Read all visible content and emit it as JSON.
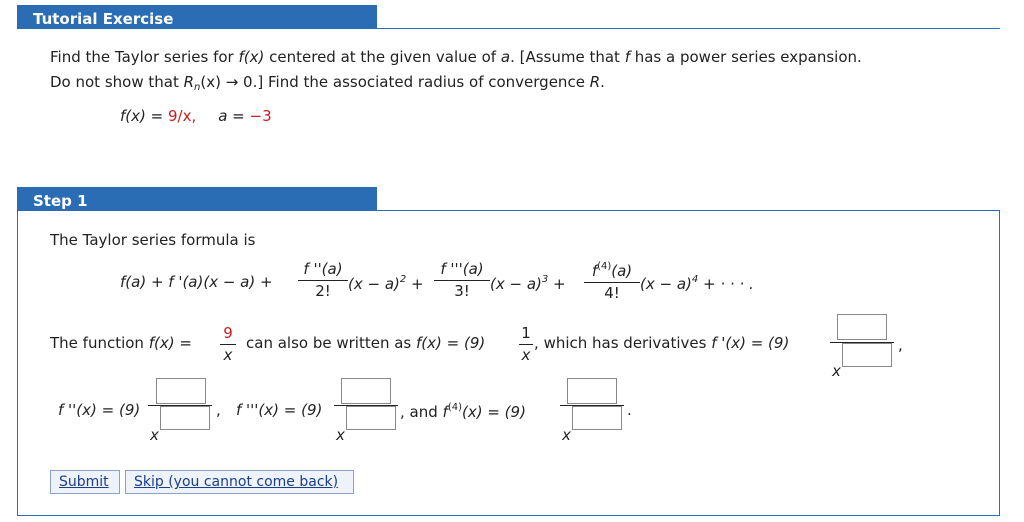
{
  "tutorial": {
    "header": "Tutorial Exercise",
    "line1_a": "Find the Taylor series for ",
    "line1_fx": "f(x)",
    "line1_b": " centered at the given value of ",
    "line1_a_var": "a",
    "line1_c": ". [Assume that ",
    "line1_f": "f",
    "line1_d": " has a power series expansion.",
    "line2_a": "Do not show that ",
    "line2_rn": "R",
    "line2_n": "n",
    "line2_b": "(x) → 0.] Find the associated radius of convergence ",
    "line2_R": "R",
    "line2_c": ".",
    "given_f": "f(x) = ",
    "given_fval": "9/x,",
    "given_a": "a = ",
    "given_aval": "−3"
  },
  "step1": {
    "header": "Step 1",
    "intro": "The Taylor series formula is",
    "formula": {
      "t0": "f(a) + f '(a)(x − a) + ",
      "n2": "f ''(a)",
      "d2": "2!",
      "t2": "(x − a)",
      "p2": "2",
      "plus": " + ",
      "n3": "f '''(a)",
      "d3": "3!",
      "t3": "(x − a)",
      "p3": "3",
      "n4a": "f",
      "n4p": "(4)",
      "n4b": "(a)",
      "d4": "4!",
      "t4": "(x − a)",
      "p4": "4",
      "tail": " + · · · ."
    },
    "func_intro": "The function ",
    "fx_eq": "f(x) = ",
    "num9": "9",
    "den_x": "x",
    "also": "can also be written as ",
    "fx_eq2": "f(x) = (9)",
    "num1": "1",
    "comma1": ",",
    "which": "which has derivatives ",
    "fp": "f '(x) = (9)",
    "comma2": ",",
    "fpp": "f ''(x) = (9)",
    "fppp": "f '''(x) = (9)",
    "and": ", and ",
    "f4a": "f",
    "f4p": "(4)",
    "f4b": "(x) = (9)",
    "period": ".",
    "comma3": ",",
    "comma4": ","
  },
  "buttons": {
    "submit": "Submit",
    "skip": "Skip (you cannot come back)"
  },
  "colors": {
    "accent": "#2a6db5",
    "red": "#c81e1e"
  }
}
